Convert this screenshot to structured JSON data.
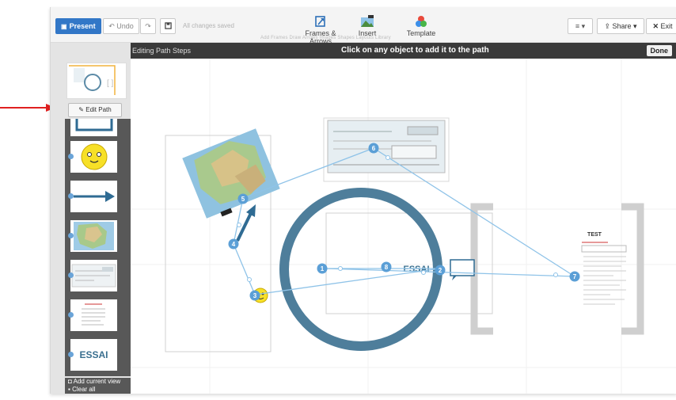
{
  "toolbar": {
    "present_label": "Present",
    "undo_label": "Undo",
    "saved_status": "All changes saved",
    "tools": [
      {
        "label": "Frames & Arrows",
        "icon": "frames-arrows-icon"
      },
      {
        "label": "Insert",
        "icon": "insert-image-icon"
      },
      {
        "label": "Template",
        "icon": "template-icon"
      }
    ],
    "sub_text": "Add Frames    Draw Arrows    Images    Shapes    Layouts    Library",
    "share_label": "Share",
    "exit_label": "Exit"
  },
  "path_bar": {
    "title": "Editing Path Steps",
    "instruction": "Click on any object to add it to the path",
    "done_label": "Done"
  },
  "sidebar": {
    "edit_path_label": "Edit Path",
    "thumb_essai_text": "ESSAI",
    "add_current_view": "Add current view",
    "clear_all": "Clear all"
  },
  "canvas": {
    "essai_text": "ESSAI",
    "test_doc_title": "TEST",
    "path_steps": [
      "1",
      "2",
      "3",
      "4",
      "5",
      "6",
      "7",
      "8"
    ]
  },
  "colors": {
    "accent": "#3277c7",
    "path_line": "#8fc3e8",
    "step_badge": "#5b9fd6",
    "ring": "#4e7e9b",
    "annotation_arrow": "#e02020"
  }
}
